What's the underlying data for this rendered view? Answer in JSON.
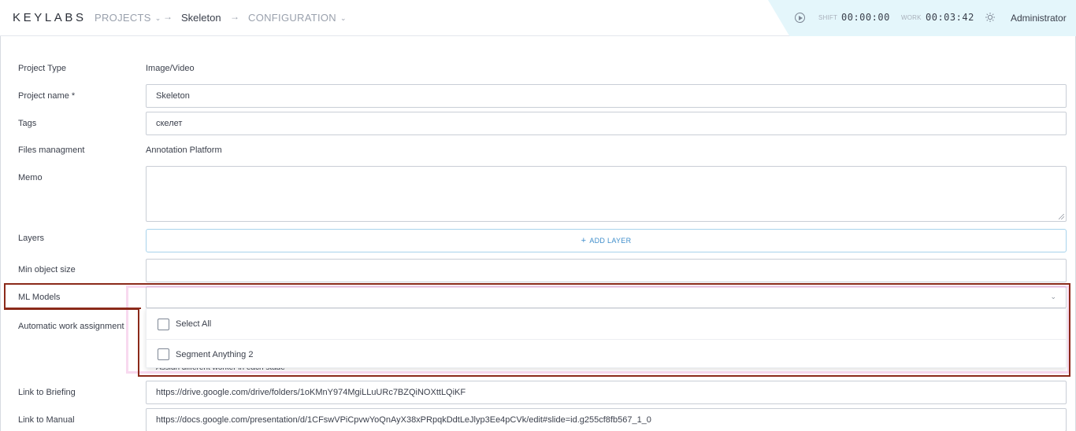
{
  "header": {
    "logo": "KEYLABS",
    "breadcrumbs": [
      {
        "label": "PROJECTS"
      },
      {
        "label": "Skeleton"
      },
      {
        "label": "CONFIGURATION"
      }
    ],
    "shift_label": "SHIFT",
    "shift_value": "00:00:00",
    "work_label": "WORK",
    "work_value": "00:03:42",
    "user": "Administrator"
  },
  "form": {
    "project_type": {
      "label": "Project Type",
      "value": "Image/Video"
    },
    "project_name": {
      "label": "Project name *",
      "value": "Skeleton"
    },
    "tags": {
      "label": "Tags",
      "value": "скелет"
    },
    "files_management": {
      "label": "Files managment",
      "value": "Annotation Platform"
    },
    "memo": {
      "label": "Memo",
      "value": ""
    },
    "layers": {
      "label": "Layers",
      "button": "ADD LAYER"
    },
    "min_object_size": {
      "label": "Min object size",
      "value": ""
    },
    "ml_models": {
      "label": "ML Models",
      "value": "",
      "options": [
        "Select All",
        "Segment Anything 2"
      ]
    },
    "auto_assignment": {
      "label": "Automatic work assignment",
      "hidden_checkbox": "Assign different worker in each stage"
    },
    "link_briefing": {
      "label": "Link to Briefing",
      "value": "https://drive.google.com/drive/folders/1oKMnY974MgiLLuURc7BZQiNOXttLQiKF"
    },
    "link_manual": {
      "label": "Link to Manual",
      "value": "https://docs.google.com/presentation/d/1CFswVPiCpvwYoQnAyX38xPRpqkDdtLeJlyp3Ee4pCVk/edit#slide=id.g255cf8fb567_1_0"
    }
  },
  "colors": {
    "accent": "#3f8ecb",
    "highlight": "#8b2a1a",
    "timer_bg": "#e4f6fb"
  }
}
